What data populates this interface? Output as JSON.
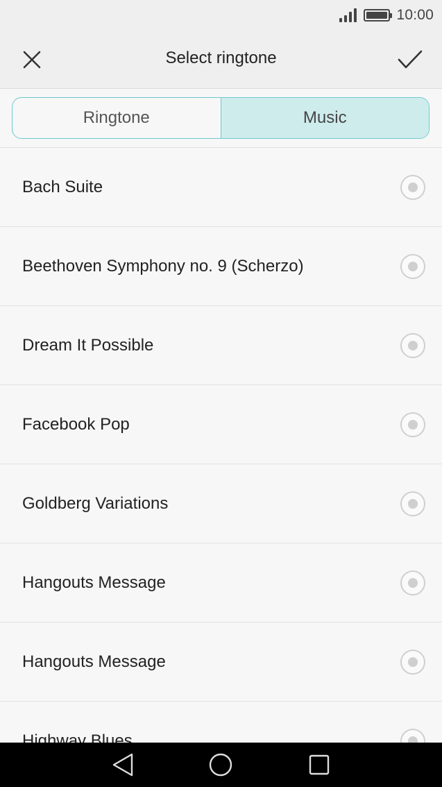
{
  "status_bar": {
    "time": "10:00",
    "icons": [
      "signal-icon",
      "battery-icon"
    ]
  },
  "title_bar": {
    "title": "Select ringtone",
    "close_icon": "close-icon",
    "confirm_icon": "check-icon"
  },
  "tabs": [
    {
      "label": "Ringtone",
      "active": false
    },
    {
      "label": "Music",
      "active": true
    }
  ],
  "list": {
    "items": [
      {
        "label": "Bach Suite"
      },
      {
        "label": "Beethoven Symphony no. 9 (Scherzo)"
      },
      {
        "label": "Dream It Possible"
      },
      {
        "label": "Facebook Pop"
      },
      {
        "label": "Goldberg Variations"
      },
      {
        "label": "Hangouts Message"
      },
      {
        "label": "Hangouts Message"
      },
      {
        "label": "Highway Blues"
      }
    ]
  },
  "nav_bar": {
    "icons": [
      "back-icon",
      "home-icon",
      "recent-apps-icon"
    ]
  },
  "colors": {
    "accent": "#6cc9ce",
    "active_tab_bg": "#cfeced",
    "nav_bg": "#000000"
  }
}
